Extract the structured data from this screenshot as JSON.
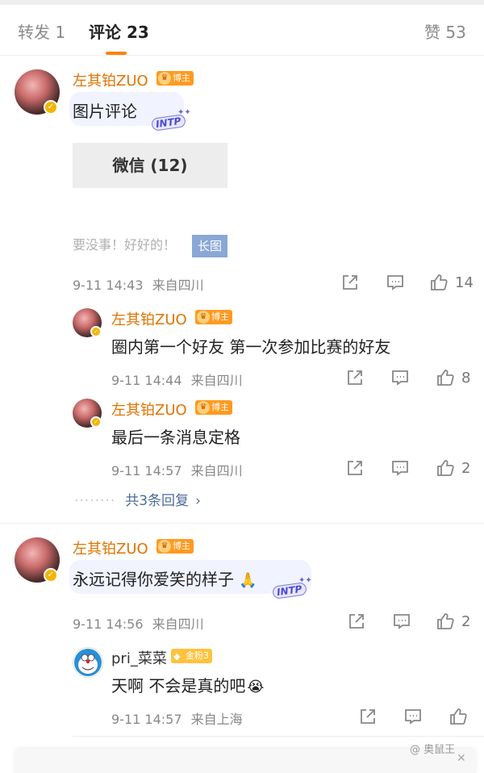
{
  "tabs": [
    {
      "label": "转发 1"
    },
    {
      "label": "评论 23"
    },
    {
      "label": "赞 53"
    }
  ],
  "colors": {
    "accent": "#ff8200",
    "username": "#e07400",
    "link": "#4d6b99"
  },
  "comments": [
    {
      "user": "左其铂ZUO",
      "badge": "博主",
      "text": "图片评论",
      "sticker": "INTP",
      "image_label": "微信 (12)",
      "image_text": "要没事！好好的！",
      "image_badge": "长图",
      "time": "9-11 14:43",
      "location": "来自四川",
      "likes": "14",
      "replies": [
        {
          "user": "左其铂ZUO",
          "badge": "博主",
          "text": "圈内第一个好友 第一次参加比赛的好友",
          "time": "9-11 14:44",
          "location": "来自四川",
          "likes": "8"
        },
        {
          "user": "左其铂ZUO",
          "badge": "博主",
          "text": "最后一条消息定格",
          "time": "9-11 14:57",
          "location": "来自四川",
          "likes": "2"
        }
      ],
      "more_replies": "共3条回复"
    },
    {
      "user": "左其铂ZUO",
      "badge": "博主",
      "text": "永远记得你爱笑的样子",
      "emoji": "🙏",
      "sticker": "INTP",
      "time": "9-11 14:56",
      "location": "来自四川",
      "likes": "2",
      "replies": [
        {
          "user": "pri_菜菜",
          "badge": "金粉3",
          "text": "天啊 不会是真的吧",
          "emoji": "😭",
          "time": "9-11 14:57",
          "location": "来自上海",
          "likes": ""
        }
      ]
    }
  ],
  "watermark": "@ 奥鼠王",
  "icons": [
    "share-icon",
    "comment-icon",
    "like-icon",
    "verified-icon",
    "close-icon"
  ]
}
